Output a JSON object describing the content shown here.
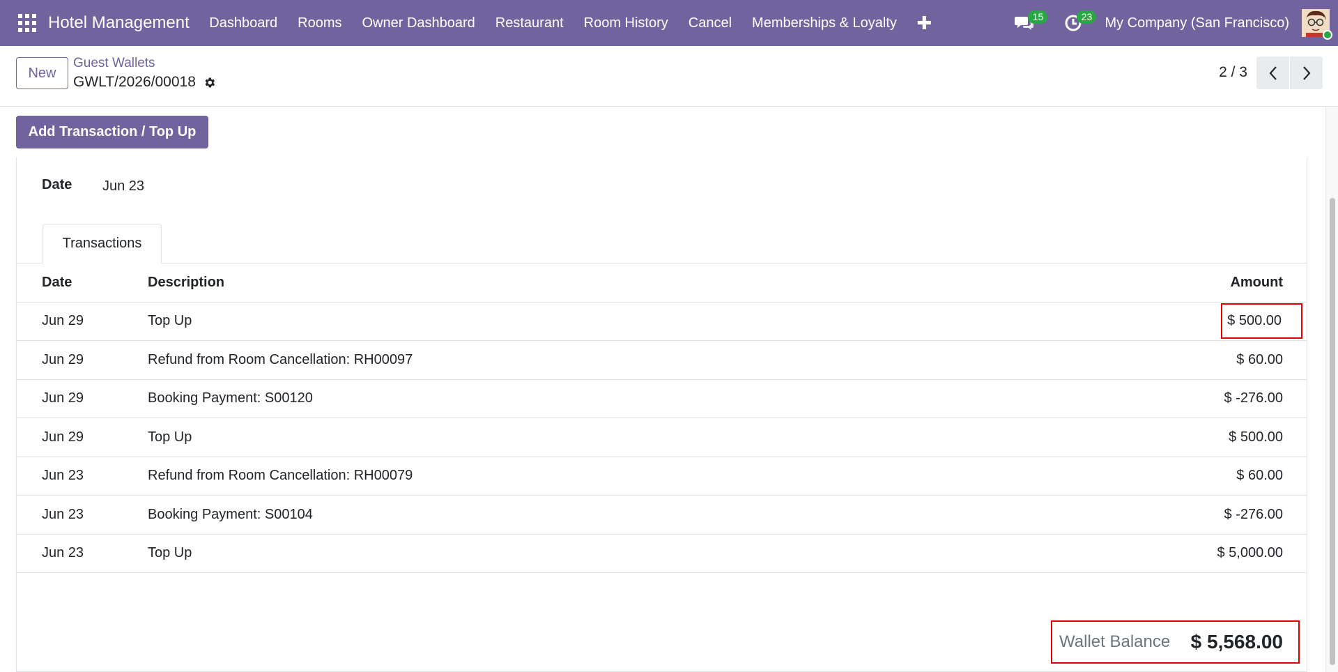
{
  "navbar": {
    "brand": "Hotel Management",
    "menu": [
      "Dashboard",
      "Rooms",
      "Owner Dashboard",
      "Restaurant",
      "Room History",
      "Cancel",
      "Memberships & Loyalty"
    ],
    "messages_count": "15",
    "activities_count": "23",
    "company": "My Company (San Francisco)",
    "icons": [
      "apps-grid-icon",
      "plus-icon",
      "chat-icon",
      "clock-icon",
      "avatar"
    ]
  },
  "control": {
    "new_label": "New",
    "breadcrumb": "Guest Wallets",
    "record_name": "GWLT/2026/00018",
    "pager": "2 / 3"
  },
  "form": {
    "action_label": "Add Transaction / Top Up",
    "date_label": "Date",
    "date_value": "Jun 23",
    "tab_label": "Transactions",
    "columns": {
      "date": "Date",
      "description": "Description",
      "amount": "Amount"
    },
    "rows": [
      {
        "date": "Jun 29",
        "description": "Top Up",
        "amount": "$ 500.00"
      },
      {
        "date": "Jun 29",
        "description": "Refund from Room Cancellation: RH00097",
        "amount": "$ 60.00"
      },
      {
        "date": "Jun 29",
        "description": "Booking Payment: S00120",
        "amount": "$ -276.00"
      },
      {
        "date": "Jun 29",
        "description": "Top Up",
        "amount": "$ 500.00"
      },
      {
        "date": "Jun 23",
        "description": "Refund from Room Cancellation: RH00079",
        "amount": "$ 60.00"
      },
      {
        "date": "Jun 23",
        "description": "Booking Payment: S00104",
        "amount": "$ -276.00"
      },
      {
        "date": "Jun 23",
        "description": "Top Up",
        "amount": "$ 5,000.00"
      }
    ],
    "balance_label": "Wallet Balance",
    "balance_value": "$ 5,568.00"
  },
  "colors": {
    "primary": "#71639e",
    "badge": "#28a745",
    "highlight": "#e00000"
  }
}
